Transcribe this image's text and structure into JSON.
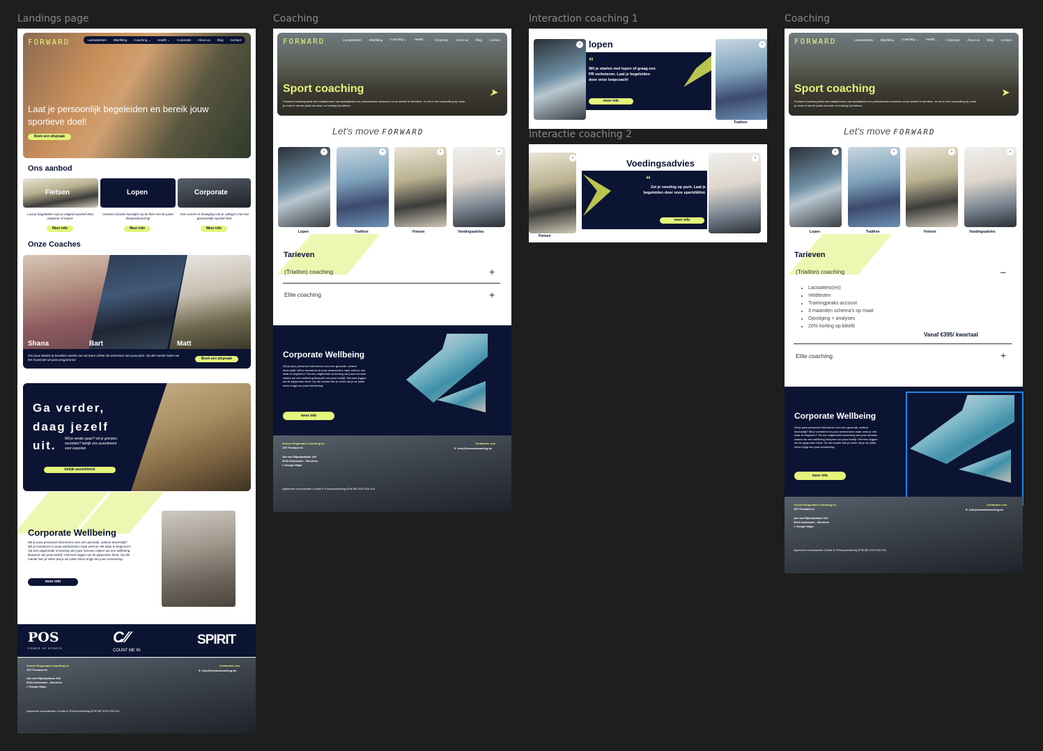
{
  "frames": {
    "landing": "Landings page",
    "coaching": "Coaching",
    "interaction1": "Interaction coaching 1",
    "interaction2": "Interactie coaching 2",
    "coaching2": "Coaching"
  },
  "brand": {
    "logo": "FORWARD",
    "lime": "#e4f57a",
    "navy": "#0b1433"
  },
  "nav": {
    "landing": [
      "Lactaattesten",
      "Bikefitting",
      "Coaching ⌄",
      "Health ⌄",
      "Corporate",
      "About us",
      "Blog",
      "Contact"
    ],
    "coaching": [
      "Lactaattesten",
      "Bikefitting",
      "Coaching ⌄",
      "Health ⌄",
      "Corporate",
      "About us",
      "Blog",
      "Contact"
    ]
  },
  "landing": {
    "hero_text": "Laat je persoonlijk begeleiden en bereik jouw sportieve doel!",
    "hero_button": "Boek een afspraak",
    "aanbod_title": "Ons aanbod",
    "aanbod": [
      {
        "label": "Fietsen",
        "desc": "Laat je begeleiden naar je volgend sportief doel, beginner of expert.",
        "more": "Meer info"
      },
      {
        "label": "Lopen",
        "desc": "Voorkom fysieke kwaaltjes op de fiets met de juiste fietspositionering!",
        "more": "Meer info"
      },
      {
        "label": "Corporate",
        "desc": "Kom samen in beweging met je collega's met een gezamenlijk sportief doel.",
        "more": "Meer info"
      }
    ],
    "coaches_title": "Onze Coaches",
    "coaches": [
      "Shana",
      "Bart",
      "Matt"
    ],
    "coaches_text": "Om jouw doelen te bereiken werken we als team achter de schermen aan jouw plan. Op die manier halen we het maximale uit jouw programma!",
    "coaches_button": "Boek een afspraak",
    "verder_title": "Ga verder, daag jezelf uit.",
    "verder_text": "Wil je verder gaan? wil je grenzen verzetten? bekijk ons assortiment voor experten",
    "verder_button": "bekijk assortiment",
    "wellbeing_title": "Corporate Wellbeing",
    "wellbeing_text": "Wil je jouw personeel informeren over een gezonde, actieve levensstijl? Wil je investeren in jouw werknemers maar weet je niet waar te beginnen? Via een uitgebreide screening van jouw mensen maken we een wellbeing blueprint van jouw bedrijf. Hiermee leggen we de pijnpunten bloot. Op die manier ben je zeker dat je de juiste return krijgt van jouw investering.",
    "wellbeing_button": "meer info",
    "partners": [
      "POS",
      "POWER OF SPORTS",
      "COUNT ME IN",
      "SPIRIT"
    ]
  },
  "footer": {
    "company": "Jeroen Dingemans Coaching bv",
    "company_sub": "JST Forward bv",
    "street": "Jan van Rijswijcklaan 154",
    "city": "2018 Antwerpen - Berchem",
    "maps": "Google Maps",
    "contact_title": "Contacteer ons",
    "email": "E. info@forwardcoaching.be",
    "legal": "Algemene voorwaarden Cookie & Privacyverklaring BTW BE 0703 026 514"
  },
  "coaching": {
    "hero_title": "Sport coaching",
    "hero_text": "Forward Coaching biedt een totaalformule van lactaattesten en professionele schema's om je doelen te bereiken. Je zet er een versnelling bij, maar je moet er wel de juiste structuur en training bij hebben.",
    "tagline_prefix": "Let's move",
    "tagline_logo": "FORWARD",
    "cards": [
      "Lopen",
      "Traithon",
      "Fietsen",
      "Voedingsadvies"
    ],
    "tarieven_title": "Tarieven",
    "tarief1": "(Triatlon) coaching",
    "tarief2": "Elite coaching",
    "tarief_items": [
      "Lactaattest(en)",
      "Veldtesten",
      "Trainingpeaks account",
      "3 maanden schema's op maat",
      "Opvolging + analyses",
      "20% korting op bikefit"
    ],
    "price": "Vanaf €395/ kwartaal",
    "wellbeing_title": "Corporate Wellbeing",
    "wellbeing_text": "Wil je jouw personeel informeren over een gezonde, actieve levensstijl? Wil je investeren in jouw werknemers maar weet je niet waar te beginnen? Via een uitgebreide screening van jouw mensen maken we een wellbeing blueprint van jouw bedrijf. Hiermee leggen we de pijnpunten bloot. Op die manier ben je zeker dat je de juiste return krijgt van jouw investering.",
    "wellbeing_button": "meer info"
  },
  "interaction1": {
    "title": "lopen",
    "quote": "Wil je starten met lopen of graag een PR verbeteren. Laat je begeleiden door onze loopcoach!",
    "button": "meer info",
    "side_label": "Traithon"
  },
  "interaction2": {
    "title": "Voedingsadvies",
    "quote": "Zet je voeding op punt. Laat je begeleiden door onze sportdiëtist.",
    "button": "meer info",
    "side_label": "Fietsen"
  }
}
